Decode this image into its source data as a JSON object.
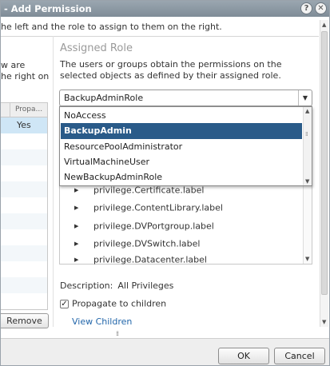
{
  "window": {
    "title": "- Add Permission",
    "help_glyph": "?",
    "close_glyph": "✕"
  },
  "instruction": "he left and the role to assign to them on the right.",
  "left": {
    "desc_lines": [
      "w are",
      "he right on"
    ],
    "table": {
      "col_header": "Propa...",
      "rows": [
        {
          "value": "Yes"
        }
      ]
    },
    "remove_label": "Remove"
  },
  "role": {
    "heading": "Assigned Role",
    "description": "The users or groups obtain the permissions on the selected objects as defined by their assigned role.",
    "selected": "BackupAdminRole",
    "options": [
      "NoAccess",
      "BackupAdmin",
      "ResourcePoolAdministrator",
      "VirtualMachineUser",
      "NewBackupAdminRole"
    ],
    "highlighted_option": "BackupAdmin"
  },
  "privileges": [
    "privilege.Certificate.label",
    "privilege.ContentLibrary.label",
    "privilege.DVPortgroup.label",
    "privilege.DVSwitch.label",
    "privilege.Datacenter.label"
  ],
  "description": {
    "label": "Description:",
    "value": "All Privileges"
  },
  "propagate": {
    "label": "Propagate to children",
    "checked": true,
    "check_glyph": "✓"
  },
  "view_children": "View Children",
  "footer": {
    "ok_label": "OK",
    "cancel_label": "Cancel"
  },
  "colors": {
    "selection": "#2a5b89",
    "link": "#2266aa",
    "titlebar": "#8c98a3"
  }
}
